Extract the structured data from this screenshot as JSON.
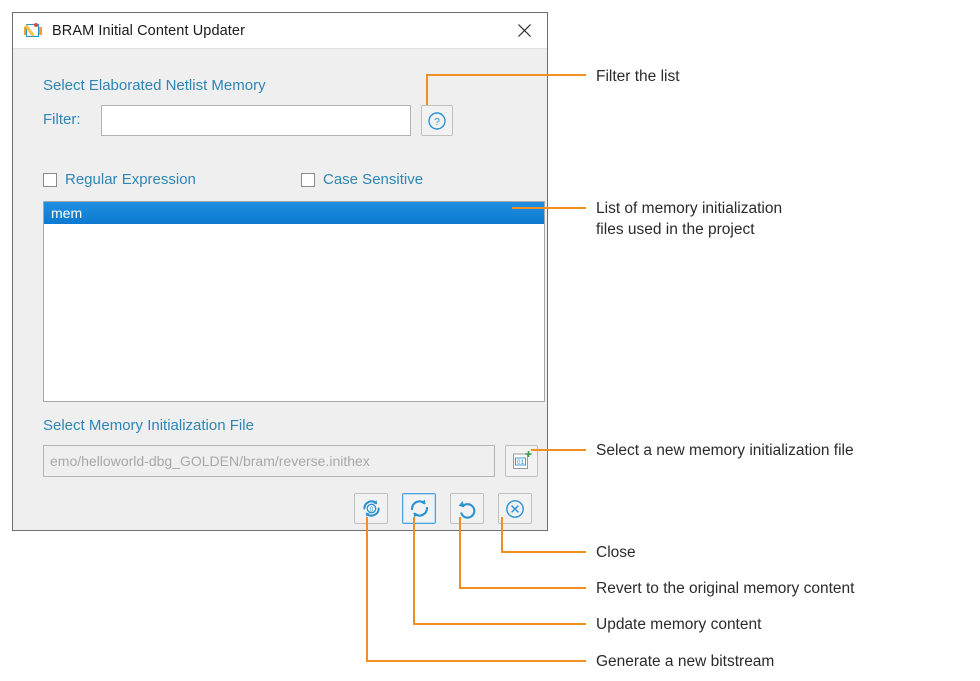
{
  "window": {
    "title": "BRAM Initial Content Updater",
    "app_icon": "bram-updater-icon",
    "close_icon": "close-icon"
  },
  "sections": {
    "netlist_memory": {
      "title": "Select Elaborated Netlist Memory",
      "filter_label": "Filter:",
      "filter_value": "",
      "filter_placeholder": "",
      "help_icon": "question-mark-icon",
      "checkboxes": [
        {
          "label": "Regular Expression",
          "checked": false
        },
        {
          "label": "Case Sensitive",
          "checked": false
        }
      ],
      "list_items": [
        {
          "label": "mem",
          "selected": true
        }
      ]
    },
    "init_file": {
      "title": "Select Memory Initialization File",
      "path_value": "emo/helloworld-dbg_GOLDEN/bram/reverse.inithex",
      "browse_icon": "new-init-file-icon"
    }
  },
  "action_buttons": [
    {
      "name": "generate-bitstream-button",
      "icon": "bitstream-refresh-icon",
      "focused": false
    },
    {
      "name": "update-memory-button",
      "icon": "refresh-circular-icon",
      "focused": true
    },
    {
      "name": "revert-memory-button",
      "icon": "undo-arrow-icon",
      "focused": false
    },
    {
      "name": "close-dialog-button",
      "icon": "close-circle-icon",
      "focused": false
    }
  ],
  "annotations": [
    {
      "id": "filter",
      "text": "Filter the list"
    },
    {
      "id": "list",
      "text": "List of memory initialization\nfiles used in the project"
    },
    {
      "id": "browse",
      "text": "Select a new memory initialization file"
    },
    {
      "id": "close",
      "text": "Close"
    },
    {
      "id": "revert",
      "text": "Revert to the original memory content"
    },
    {
      "id": "update",
      "text": "Update memory content"
    },
    {
      "id": "generate",
      "text": "Generate a new bitstream"
    }
  ],
  "colors": {
    "accent_blue": "#2e86b5",
    "selection_blue": "#0d7ad0",
    "leader_orange": "#ef8f26",
    "dialog_bg": "#efefef",
    "text_dark": "#2b2b2b"
  }
}
